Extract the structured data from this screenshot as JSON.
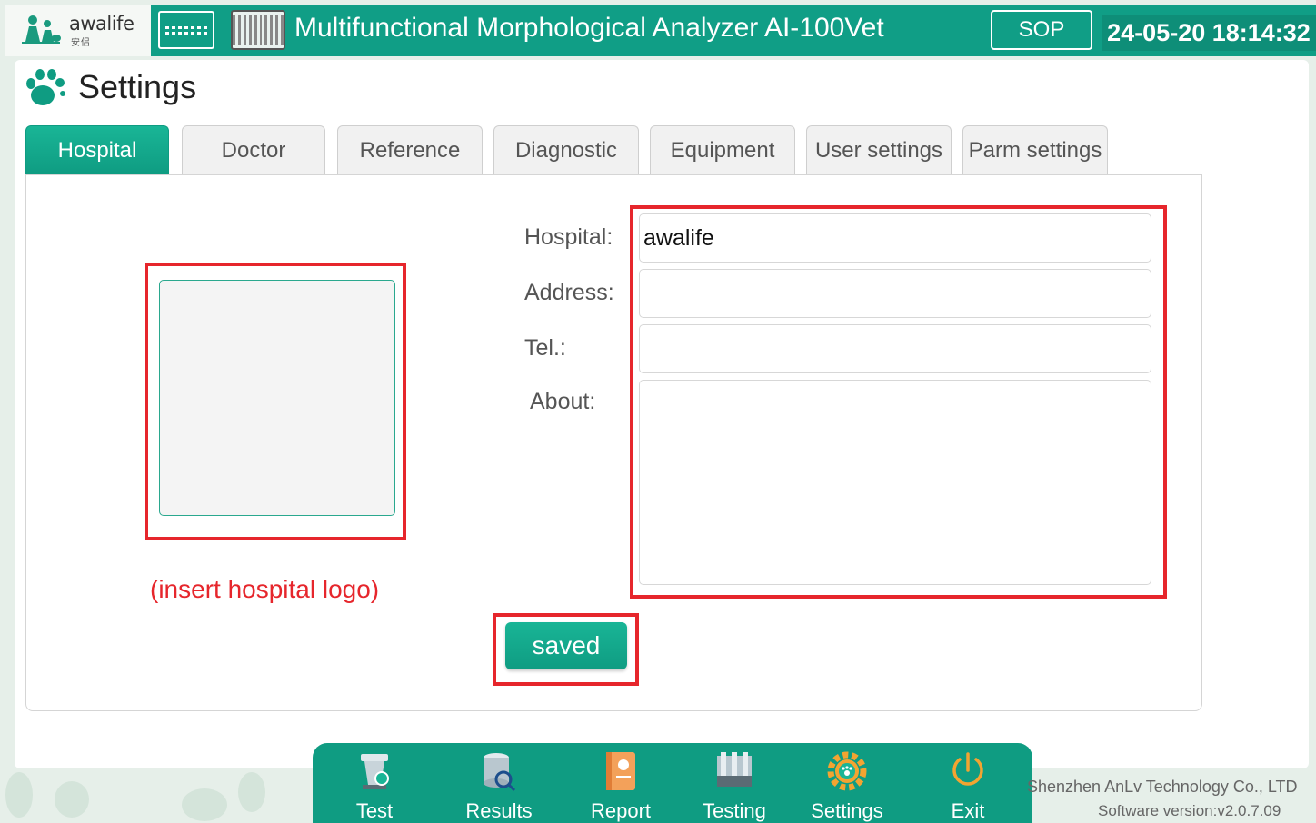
{
  "header": {
    "logo_text": "awalife",
    "logo_sub": "安侣",
    "app_title": "Multifunctional Morphological Analyzer AI-100Vet",
    "sop_label": "SOP",
    "datetime": "24-05-20 18:14:32"
  },
  "page": {
    "title": "Settings"
  },
  "tabs": [
    {
      "label": "Hospital",
      "active": true
    },
    {
      "label": "Doctor",
      "active": false
    },
    {
      "label": "Reference",
      "active": false
    },
    {
      "label": "Diagnostic",
      "active": false
    },
    {
      "label": "Equipment",
      "active": false
    },
    {
      "label": "User settings",
      "active": false
    },
    {
      "label": "Parm settings",
      "active": false
    }
  ],
  "form": {
    "logo_caption": "(insert hospital logo)",
    "hospital_label": "Hospital:",
    "hospital_value": "awalife",
    "address_label": "Address:",
    "address_value": "",
    "tel_label": "Tel.:",
    "tel_value": "",
    "about_label": "About:",
    "about_value": "",
    "save_label": "saved"
  },
  "nav": [
    {
      "label": "Test",
      "icon": "test-icon"
    },
    {
      "label": "Results",
      "icon": "results-icon"
    },
    {
      "label": "Report",
      "icon": "report-icon"
    },
    {
      "label": "Testing",
      "icon": "testing-icon"
    },
    {
      "label": "Settings",
      "icon": "settings-icon"
    },
    {
      "label": "Exit",
      "icon": "exit-icon"
    }
  ],
  "footer": {
    "company": "Shenzhen AnLv Technology Co., LTD",
    "version": "Software version:v2.0.7.09"
  },
  "colors": {
    "brand_green": "#109e86",
    "annotation_red": "#e6262c",
    "nav_green": "#0f9c82"
  }
}
